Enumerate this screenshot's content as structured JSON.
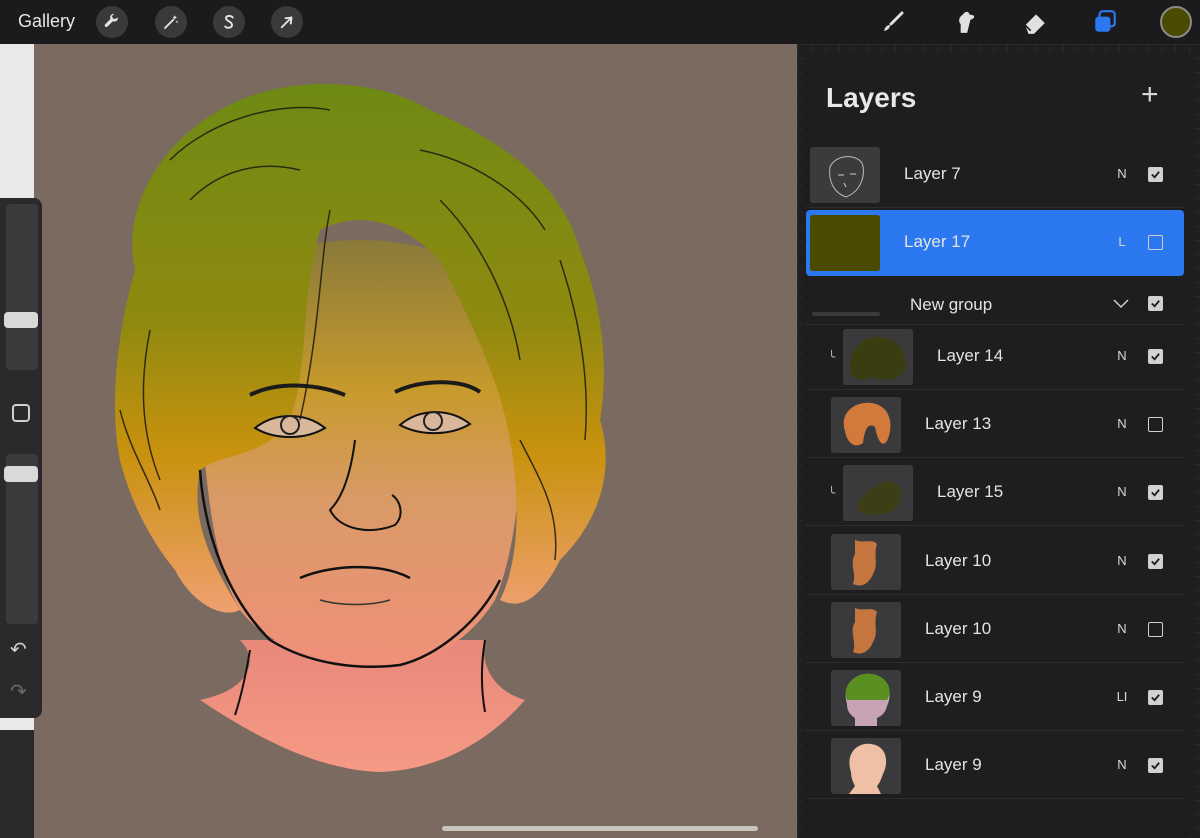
{
  "toolbar": {
    "gallery_label": "Gallery",
    "left_tools": [
      {
        "icon": "wrench-icon",
        "name": "actions-button"
      },
      {
        "icon": "magic-wand-icon",
        "name": "adjustments-button"
      },
      {
        "icon": "selection-s-icon",
        "name": "selection-button"
      },
      {
        "icon": "arrow-cursor-icon",
        "name": "transform-button"
      }
    ],
    "right_tools": [
      {
        "icon": "brush-icon",
        "name": "paint-tool-button"
      },
      {
        "icon": "smudge-icon",
        "name": "smudge-tool-button"
      },
      {
        "icon": "eraser-icon",
        "name": "eraser-tool-button"
      },
      {
        "icon": "layers-icon",
        "name": "layers-button"
      }
    ],
    "current_color": "#4a4a00",
    "accent_color": "#2b78f0"
  },
  "sidebar": {
    "modify_icon": "square-icon",
    "undo_icon": "undo-arrow-icon",
    "redo_icon": "redo-arrow-icon",
    "brush_size_level": 0.28,
    "opacity_level": 0.08
  },
  "layers": {
    "title": "Layers",
    "add_icon": "plus-icon",
    "items": [
      {
        "name": "Layer 7",
        "blend": "N",
        "visible": true,
        "selected": false,
        "indent": false,
        "clipped": false,
        "thumb": "sketch"
      },
      {
        "name": "Layer 17",
        "blend": "L",
        "visible": false,
        "selected": true,
        "indent": false,
        "clipped": false,
        "thumb": "olive"
      },
      {
        "name": "New group",
        "blend": "",
        "visible": true,
        "selected": false,
        "indent": false,
        "clipped": false,
        "thumb": "group"
      },
      {
        "name": "Layer 14",
        "blend": "N",
        "visible": true,
        "selected": false,
        "indent": true,
        "clipped": true,
        "thumb": "dark-hair"
      },
      {
        "name": "Layer 13",
        "blend": "N",
        "visible": false,
        "selected": false,
        "indent": true,
        "clipped": false,
        "thumb": "orange-hair"
      },
      {
        "name": "Layer 15",
        "blend": "N",
        "visible": true,
        "selected": false,
        "indent": true,
        "clipped": true,
        "thumb": "dark-blob"
      },
      {
        "name": "Layer 10",
        "blend": "N",
        "visible": true,
        "selected": false,
        "indent": true,
        "clipped": false,
        "thumb": "skin-shade"
      },
      {
        "name": "Layer 10",
        "blend": "N",
        "visible": false,
        "selected": false,
        "indent": true,
        "clipped": false,
        "thumb": "skin-shade"
      },
      {
        "name": "Layer 9",
        "blend": "LI",
        "visible": true,
        "selected": false,
        "indent": true,
        "clipped": false,
        "thumb": "green-pink"
      },
      {
        "name": "Layer 9",
        "blend": "N",
        "visible": true,
        "selected": false,
        "indent": true,
        "clipped": false,
        "thumb": "skin-base"
      }
    ]
  }
}
